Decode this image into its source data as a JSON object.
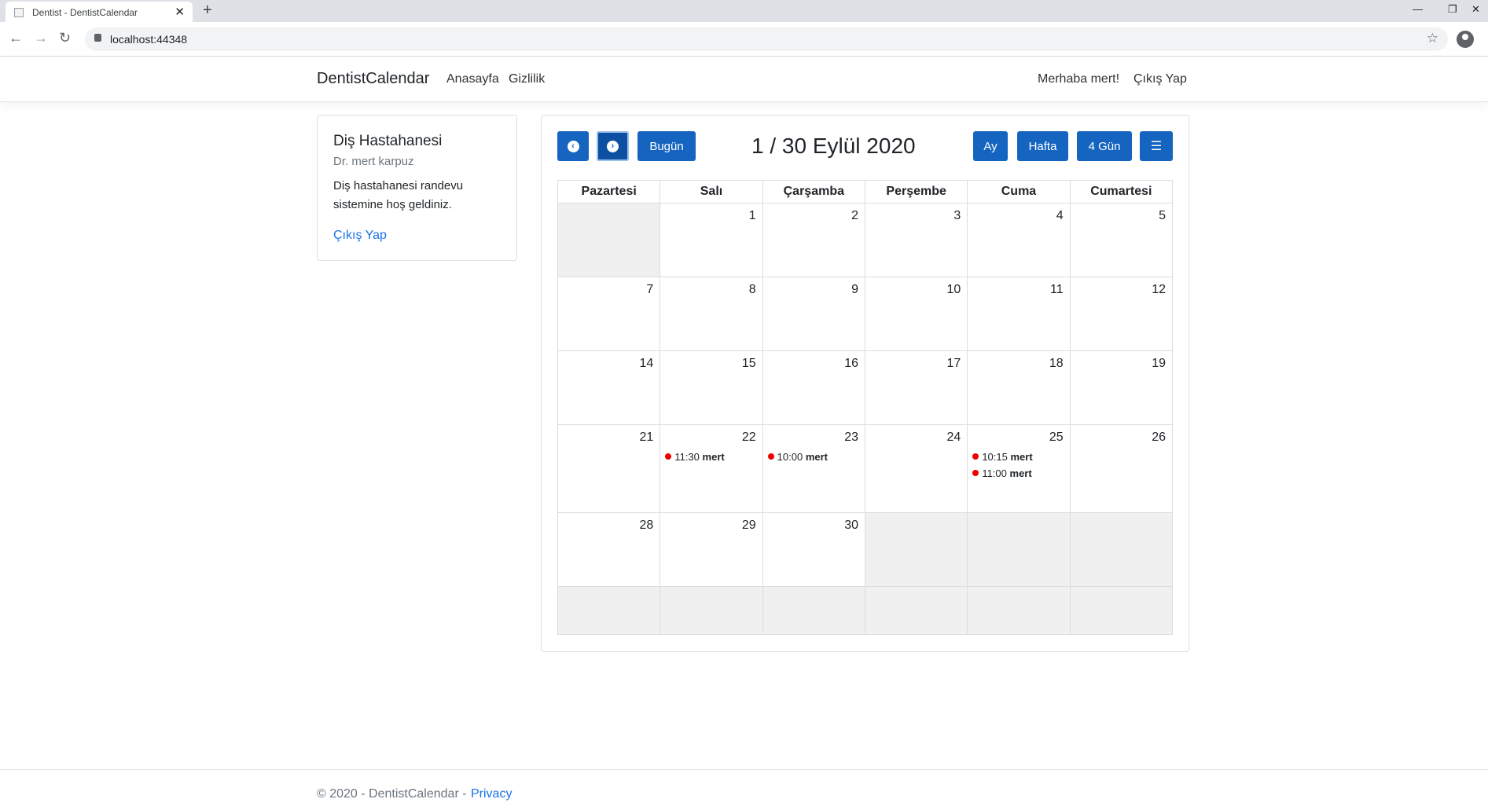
{
  "browser": {
    "tab_title": "Dentist - DentistCalendar",
    "url": "localhost:44348"
  },
  "navbar": {
    "brand": "DentistCalendar",
    "links": [
      "Anasayfa",
      "Gizlilik"
    ],
    "greeting": "Merhaba mert!",
    "logout": "Çıkış Yap"
  },
  "sidebar": {
    "title": "Diş Hastahanesi",
    "subtitle": "Dr. mert karpuz",
    "text": "Diş hastahanesi randevu sistemine hoş geldiniz.",
    "logout": "Çıkış Yap"
  },
  "calendar": {
    "today_label": "Bugün",
    "title": "1 / 30 Eylül 2020",
    "views": [
      "Ay",
      "Hafta",
      "4 Gün"
    ],
    "days": [
      "Pazartesi",
      "Salı",
      "Çarşamba",
      "Perşembe",
      "Cuma",
      "Cumartesi"
    ],
    "weeks": [
      [
        "",
        "1",
        "2",
        "3",
        "4",
        "5"
      ],
      [
        "7",
        "8",
        "9",
        "10",
        "11",
        "12"
      ],
      [
        "14",
        "15",
        "16",
        "17",
        "18",
        "19"
      ],
      [
        "21",
        "22",
        "23",
        "24",
        "25",
        "26"
      ],
      [
        "28",
        "29",
        "30",
        "",
        "",
        ""
      ],
      [
        "",
        "",
        "",
        "",
        "",
        ""
      ]
    ],
    "events": [
      {
        "week": 3,
        "day": 1,
        "time": "11:30",
        "name": "mert",
        "slot": 0
      },
      {
        "week": 3,
        "day": 2,
        "time": "10:00",
        "name": "mert",
        "slot": 0
      },
      {
        "week": 3,
        "day": 4,
        "time": "10:15",
        "name": "mert",
        "slot": 0
      },
      {
        "week": 3,
        "day": 4,
        "time": "11:00",
        "name": "mert",
        "slot": 1
      }
    ],
    "event_color": "#ee0000",
    "button_color": "#1565c0"
  },
  "footer": {
    "copyright": "© 2020 - DentistCalendar -",
    "privacy": "Privacy"
  }
}
